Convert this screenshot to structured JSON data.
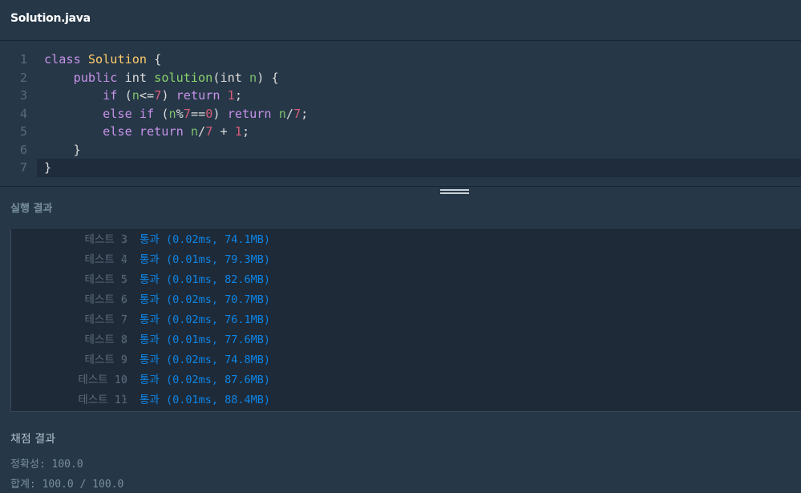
{
  "file_tab": {
    "title": "Solution.java"
  },
  "editor": {
    "line_numbers": [
      "1",
      "2",
      "3",
      "4",
      "5",
      "6",
      "7"
    ],
    "lines": [
      [
        {
          "t": "class ",
          "c": "kw"
        },
        {
          "t": "Solution",
          "c": "cls"
        },
        {
          "t": " {",
          "c": "plain"
        }
      ],
      [
        {
          "t": "    public ",
          "c": "kw"
        },
        {
          "t": "int ",
          "c": "plain"
        },
        {
          "t": "solution",
          "c": "fn"
        },
        {
          "t": "(int ",
          "c": "plain"
        },
        {
          "t": "n",
          "c": "var"
        },
        {
          "t": ") {",
          "c": "plain"
        }
      ],
      [
        {
          "t": "        if ",
          "c": "kw"
        },
        {
          "t": "(",
          "c": "plain"
        },
        {
          "t": "n",
          "c": "var"
        },
        {
          "t": "<=",
          "c": "op"
        },
        {
          "t": "7",
          "c": "num"
        },
        {
          "t": ") ",
          "c": "plain"
        },
        {
          "t": "return ",
          "c": "kw"
        },
        {
          "t": "1",
          "c": "num"
        },
        {
          "t": ";",
          "c": "plain"
        }
      ],
      [
        {
          "t": "        else if ",
          "c": "kw"
        },
        {
          "t": "(",
          "c": "plain"
        },
        {
          "t": "n",
          "c": "var"
        },
        {
          "t": "%",
          "c": "op"
        },
        {
          "t": "7",
          "c": "num"
        },
        {
          "t": "==",
          "c": "op"
        },
        {
          "t": "0",
          "c": "num"
        },
        {
          "t": ") ",
          "c": "plain"
        },
        {
          "t": "return ",
          "c": "kw"
        },
        {
          "t": "n",
          "c": "var"
        },
        {
          "t": "/",
          "c": "op"
        },
        {
          "t": "7",
          "c": "num"
        },
        {
          "t": ";",
          "c": "plain"
        }
      ],
      [
        {
          "t": "        else return ",
          "c": "kw"
        },
        {
          "t": "n",
          "c": "var"
        },
        {
          "t": "/",
          "c": "op"
        },
        {
          "t": "7",
          "c": "num"
        },
        {
          "t": " + ",
          "c": "op"
        },
        {
          "t": "1",
          "c": "num"
        },
        {
          "t": ";",
          "c": "plain"
        }
      ],
      [
        {
          "t": "    }",
          "c": "plain"
        }
      ],
      [
        {
          "t": "}",
          "c": "plain"
        }
      ]
    ],
    "current_line": 7
  },
  "results_panel": {
    "title": "실행 결과",
    "separator": "〉",
    "rows": [
      {
        "name": "테스트 3",
        "result": "통과 (0.02ms, 74.1MB)"
      },
      {
        "name": "테스트 4",
        "result": "통과 (0.01ms, 79.3MB)"
      },
      {
        "name": "테스트 5",
        "result": "통과 (0.01ms, 82.6MB)"
      },
      {
        "name": "테스트 6",
        "result": "통과 (0.02ms, 70.7MB)"
      },
      {
        "name": "테스트 7",
        "result": "통과 (0.02ms, 76.1MB)"
      },
      {
        "name": "테스트 8",
        "result": "통과 (0.01ms, 77.6MB)"
      },
      {
        "name": "테스트 9",
        "result": "통과 (0.02ms, 74.8MB)"
      },
      {
        "name": "테스트 10",
        "result": "통과 (0.02ms, 87.6MB)"
      },
      {
        "name": "테스트 11",
        "result": "통과 (0.01ms, 88.4MB)"
      }
    ]
  },
  "grading": {
    "title": "채점 결과",
    "accuracy": "정확성: 100.0",
    "total": "합계: 100.0 / 100.0"
  },
  "colors": {
    "background": "#263747",
    "results_bg": "#1e2a38",
    "pass": "#0e85e6",
    "keyword": "#c792ea",
    "class_name": "#ffcb6b",
    "function": "#8bd36b",
    "number": "#d65d79"
  }
}
